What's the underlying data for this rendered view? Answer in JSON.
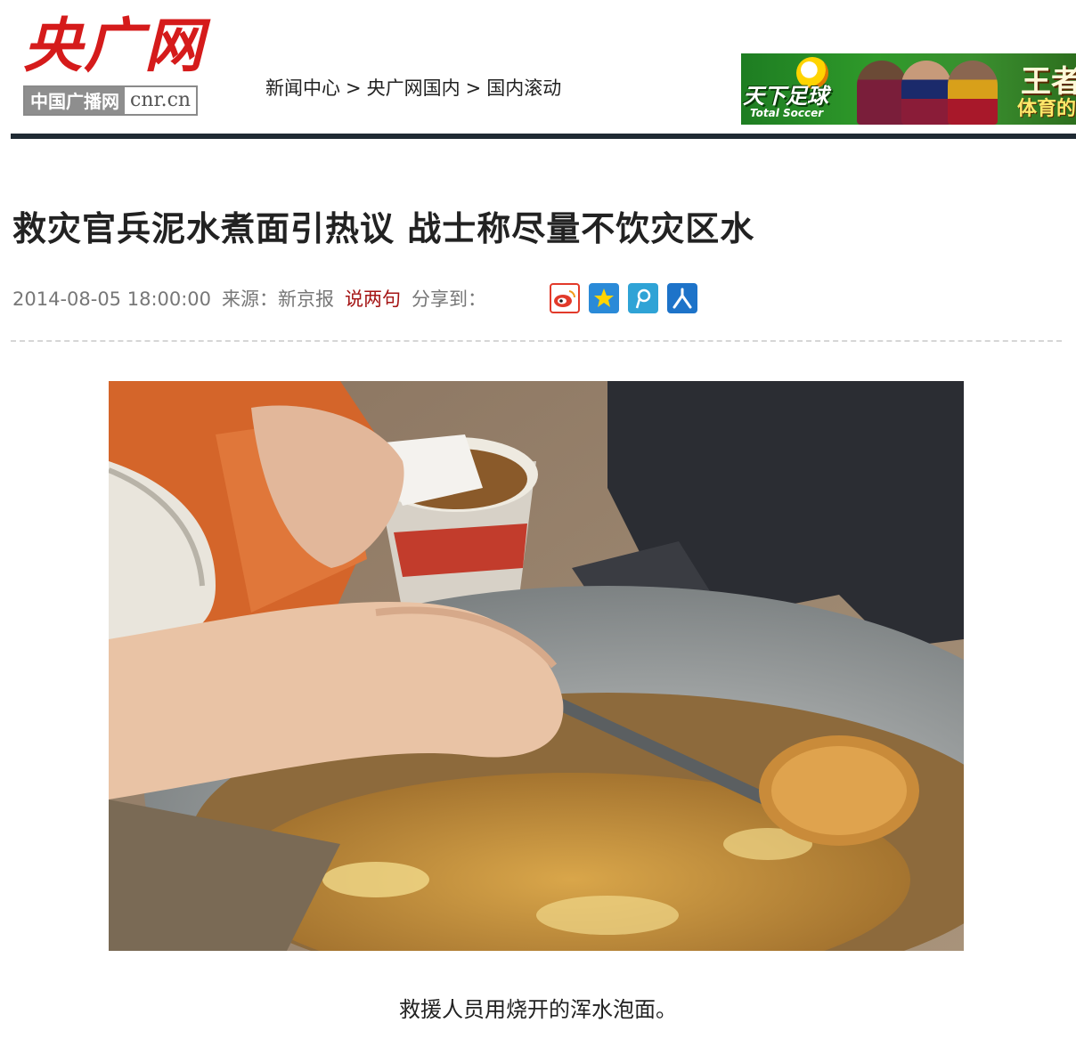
{
  "header": {
    "logo_main": "央广网",
    "logo_sub_cn": "中国广播网",
    "logo_sub_en": "cnr.cn",
    "breadcrumb": [
      "新闻中心",
      "央广网国内",
      "国内滚动"
    ],
    "breadcrumb_sep": ">"
  },
  "ad": {
    "title": "天下足球",
    "subtitle": "Total Soccer",
    "text1": "王者",
    "text2": "体育的"
  },
  "article": {
    "headline": "救灾官兵泥水煮面引热议 战士称尽量不饮灾区水",
    "datetime": "2014-08-05 18:00:00",
    "source_label": "来源：新京报",
    "comment_link": "说两句",
    "share_label": "分享到：",
    "share_icons": [
      "weibo-icon",
      "qzone-icon",
      "tencent-weibo-icon",
      "people-icon"
    ],
    "photo_caption": "救援人员用烧开的浑水泡面。"
  },
  "colors": {
    "brand_red": "#d51b1b",
    "rule": "#1f2a33",
    "comment_red": "#a51515"
  }
}
